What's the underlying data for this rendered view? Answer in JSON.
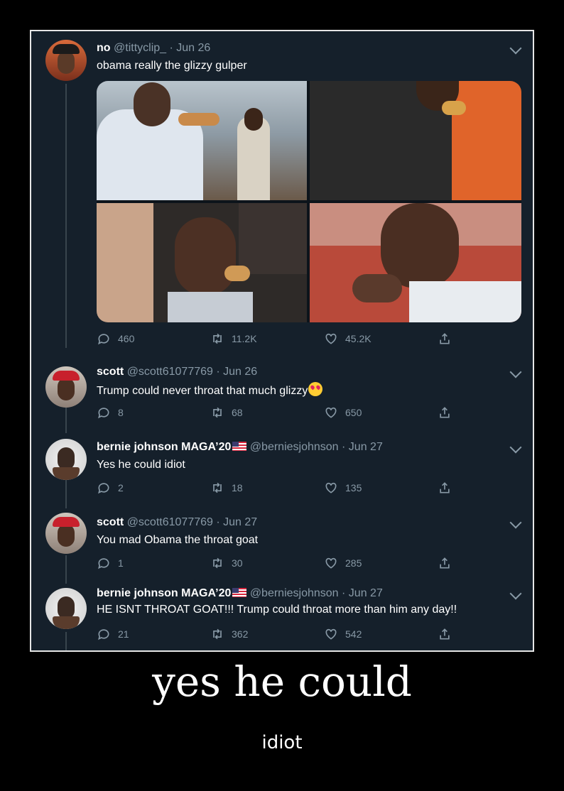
{
  "tweets": [
    {
      "name": "no",
      "handle": "@tittyclip_",
      "date": "· Jun 26",
      "text": "obama really the glizzy gulper",
      "replies": "460",
      "retweets": "11.2K",
      "likes": "45.2K"
    },
    {
      "name": "scott",
      "handle": "@scott61077769",
      "date": "· Jun 26",
      "text": "Trump could never throat that much glizzy",
      "replies": "8",
      "retweets": "68",
      "likes": "650"
    },
    {
      "name": "bernie johnson MAGA’20",
      "handle": "@berniesjohnson",
      "date": "· Jun 27",
      "text": "Yes he could idiot",
      "replies": "2",
      "retweets": "18",
      "likes": "135"
    },
    {
      "name": "scott",
      "handle": "@scott61077769",
      "date": "· Jun 27",
      "text": "You mad Obama the throat goat",
      "replies": "1",
      "retweets": "30",
      "likes": "285"
    },
    {
      "name": "bernie johnson MAGA’20",
      "handle": "@berniesjohnson",
      "date": "· Jun 27",
      "text": "HE ISNT THROAT GOAT!!! Trump could throat more than him any day!!",
      "replies": "21",
      "retweets": "362",
      "likes": "542"
    }
  ],
  "caption": {
    "title": "yes he could",
    "subtitle": "idiot"
  },
  "colors": {
    "background": "#15202b",
    "text_primary": "#ffffff",
    "text_secondary": "#8899a6",
    "thread_line": "#38444d"
  },
  "icons": [
    "chevron-down-icon",
    "reply-icon",
    "retweet-icon",
    "like-icon",
    "share-icon",
    "us-flag-icon",
    "heart-eyes-emoji"
  ]
}
